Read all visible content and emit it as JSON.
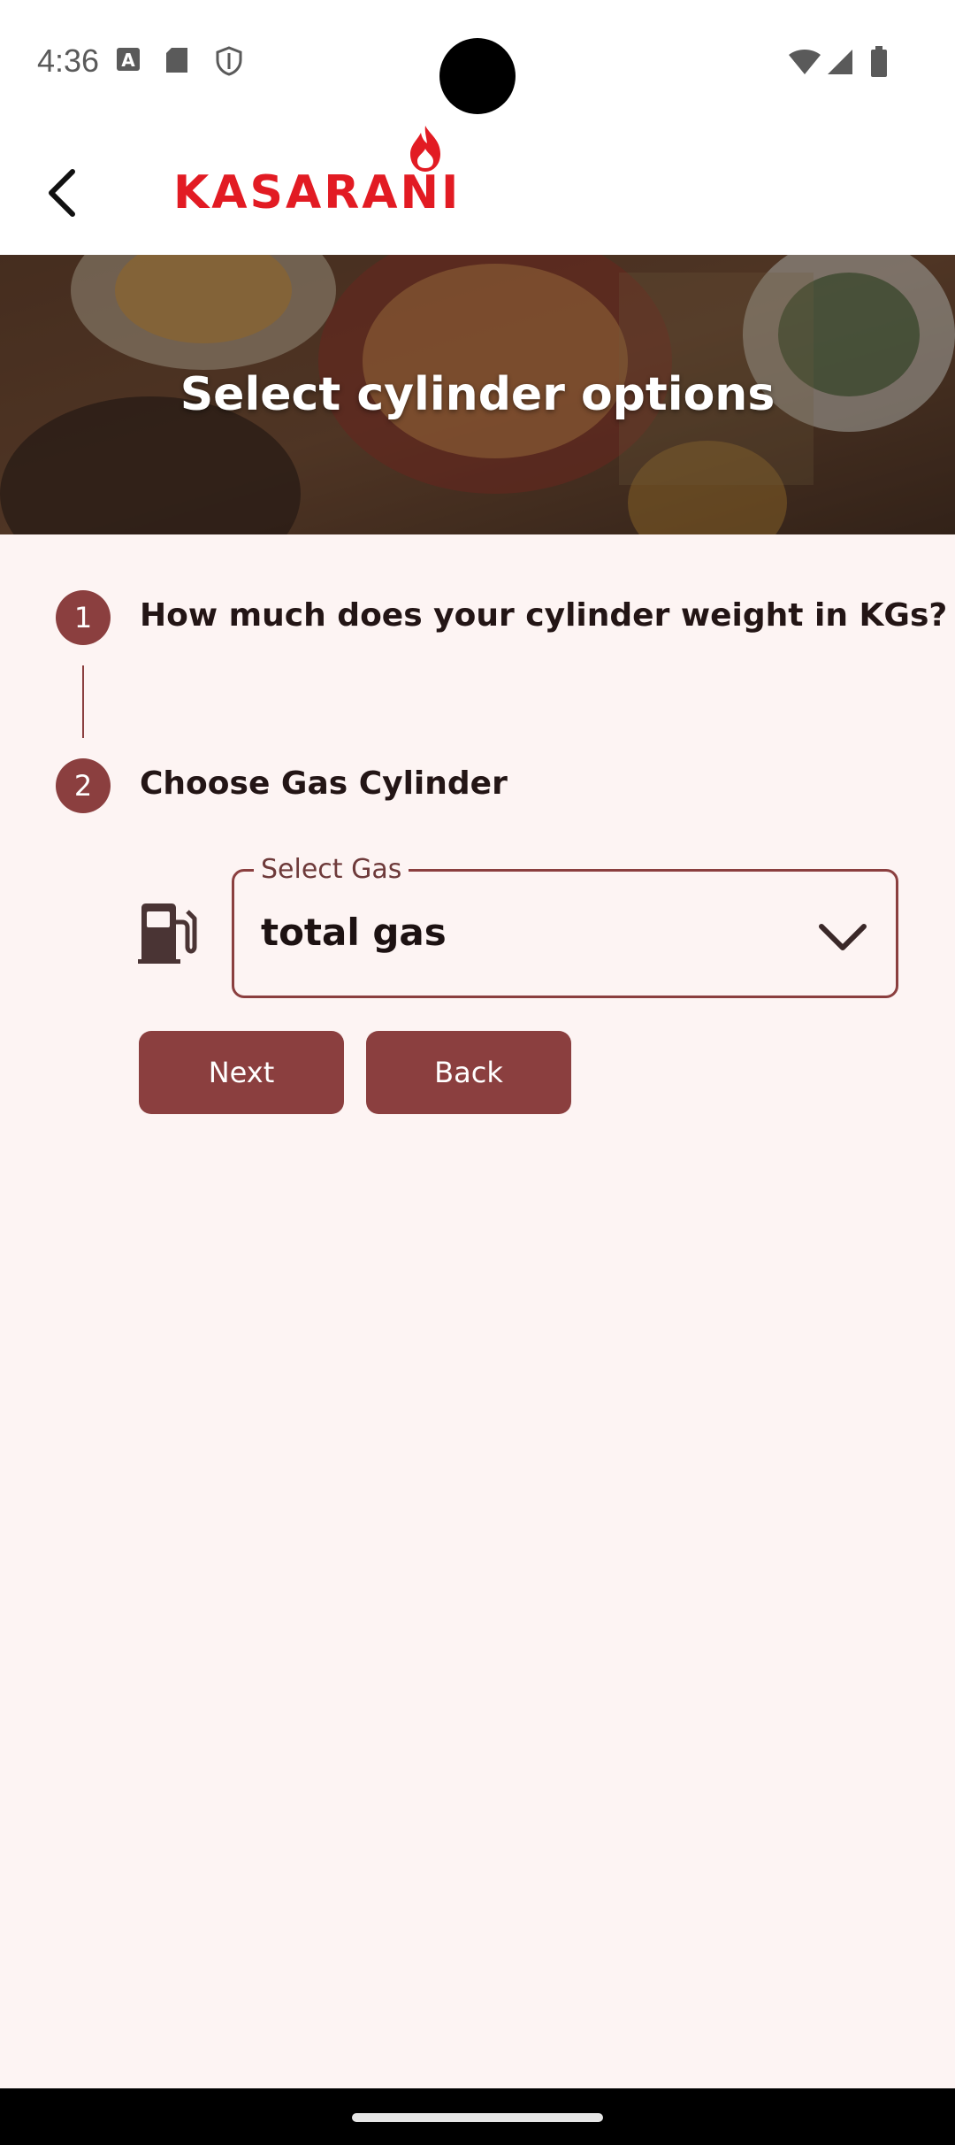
{
  "status_bar": {
    "time": "4:36",
    "left_icons": [
      "a-box-icon",
      "sd-card-icon",
      "shield-icon"
    ],
    "right_icons": [
      "wifi-icon",
      "signal-icon",
      "battery-icon"
    ]
  },
  "app_bar": {
    "brand": "KASARANI",
    "back_icon": "back-arrow-icon",
    "logo_icon": "flame-icon"
  },
  "hero": {
    "title": "Select cylinder options"
  },
  "steps": [
    {
      "number": "1",
      "title": "How much does your cylinder weight in KGs?"
    },
    {
      "number": "2",
      "title": "Choose Gas Cylinder"
    }
  ],
  "gas_select": {
    "label": "Select Gas",
    "value": "total gas",
    "icon": "gas-pump-icon"
  },
  "buttons": {
    "next": "Next",
    "back": "Back"
  },
  "colors": {
    "accent": "#8b3f3f",
    "brand": "#e21b23",
    "background": "#fdf4f3"
  }
}
